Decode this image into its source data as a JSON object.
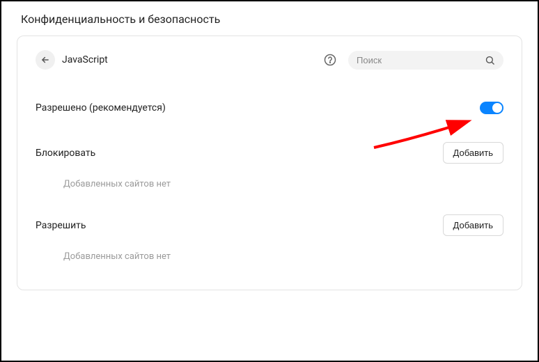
{
  "page": {
    "heading": "Конфиденциальность и безопасность"
  },
  "header": {
    "title": "JavaScript",
    "search_placeholder": "Поиск"
  },
  "allowed": {
    "label": "Разрешено (рекомендуется)",
    "enabled": true
  },
  "block_section": {
    "title": "Блокировать",
    "add_label": "Добавить",
    "empty_text": "Добавленных сайтов нет"
  },
  "allow_section": {
    "title": "Разрешить",
    "add_label": "Добавить",
    "empty_text": "Добавленных сайтов нет"
  }
}
